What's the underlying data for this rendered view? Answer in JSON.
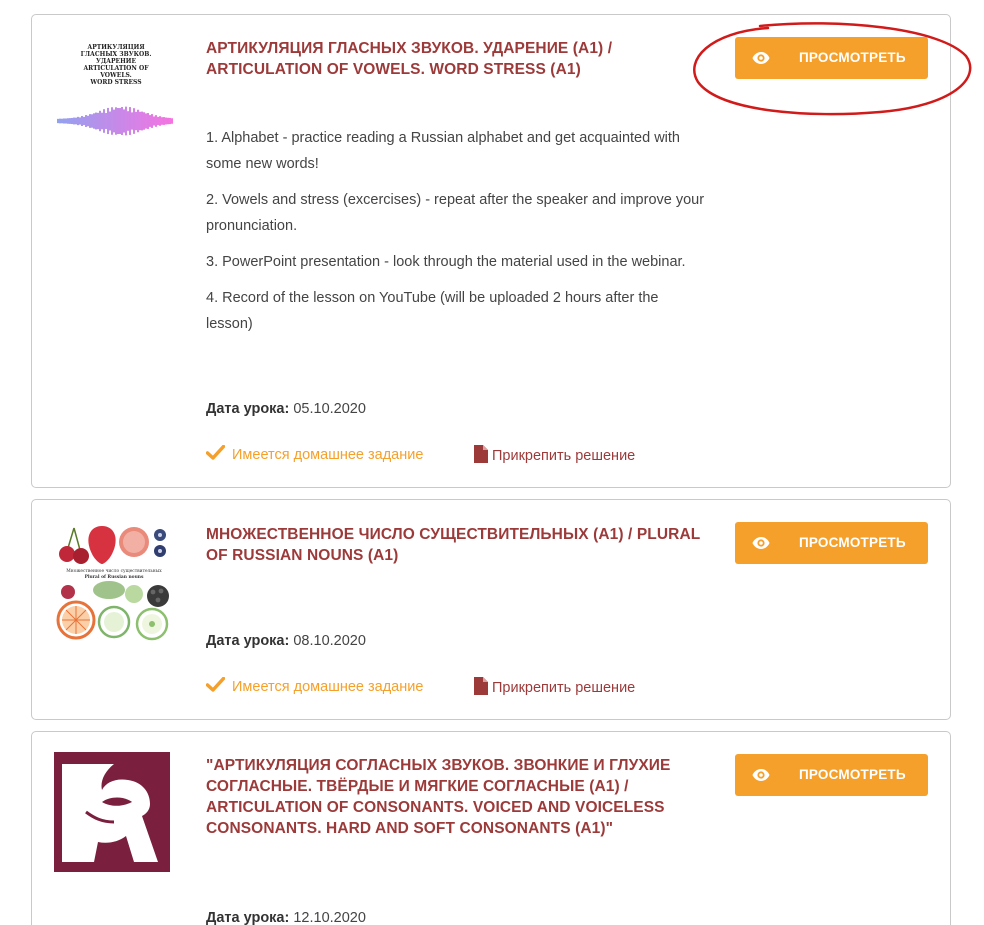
{
  "lessons": [
    {
      "title": "АРТИКУЛЯЦИЯ ГЛАСНЫХ ЗВУКОВ. УДАРЕНИЕ (А1) / ARTICULATION OF VOWELS. WORD STRESS (A1)",
      "thumb_text": [
        "АРТИКУЛЯЦИЯ",
        "ГЛАСНЫХ ЗВУКОВ.",
        "УДАРЕНИЕ",
        "ARTICULATION OF",
        "VOWELS.",
        "WORD STRESS"
      ],
      "view_label": "ПРОСМОТРЕТЬ",
      "description": [
        "1. Alphabet - practice reading a Russian alphabet and get acquainted with some new words!",
        "2. Vowels and stress (excercises) - repeat after the speaker and improve your pronunciation.",
        "3. PowerPoint presentation - look through the material used in the webinar.",
        "4. Record of the lesson on YouTube (will be uploaded 2 hours after the lesson)"
      ],
      "date_label": "Дата урока:",
      "date": "05.10.2020",
      "homework": "Имеется домашнее задание",
      "attach": "Прикрепить решение"
    },
    {
      "title": "МНОЖЕСТВЕННОЕ ЧИСЛО СУЩЕСТВИТЕЛЬНЫХ (А1) / PLURAL OF RUSSIAN NOUNS (A1)",
      "thumb_text": [
        "Множественное число существительных",
        "Plural of Russian nouns"
      ],
      "view_label": "ПРОСМОТРЕТЬ",
      "date_label": "Дата урока:",
      "date": "08.10.2020",
      "homework": "Имеется домашнее задание",
      "attach": "Прикрепить решение"
    },
    {
      "title": "\"АРТИКУЛЯЦИЯ СОГЛАСНЫХ ЗВУКОВ. ЗВОНКИЕ И ГЛУХИЕ СОГЛАСНЫЕ. ТВЁРДЫЕ И МЯГКИЕ СОГЛАСНЫЕ (А1) / ARTICULATION OF CONSONANTS. VOICED AND VOICELESS CONSONANTS. HARD AND SOFT CONSONANTS (A1)\"",
      "view_label": "ПРОСМОТРЕТЬ",
      "date_label": "Дата урока:",
      "date": "12.10.2020"
    }
  ],
  "colors": {
    "accent": "#f5a02a",
    "title": "#9c3a3a",
    "border": "#c9c9c9",
    "highlight": "#d11a1a",
    "thumb3": "#7a1f3d"
  },
  "icons": {
    "view": "eye-icon",
    "homework": "checkmark-icon",
    "attach": "file-icon"
  }
}
